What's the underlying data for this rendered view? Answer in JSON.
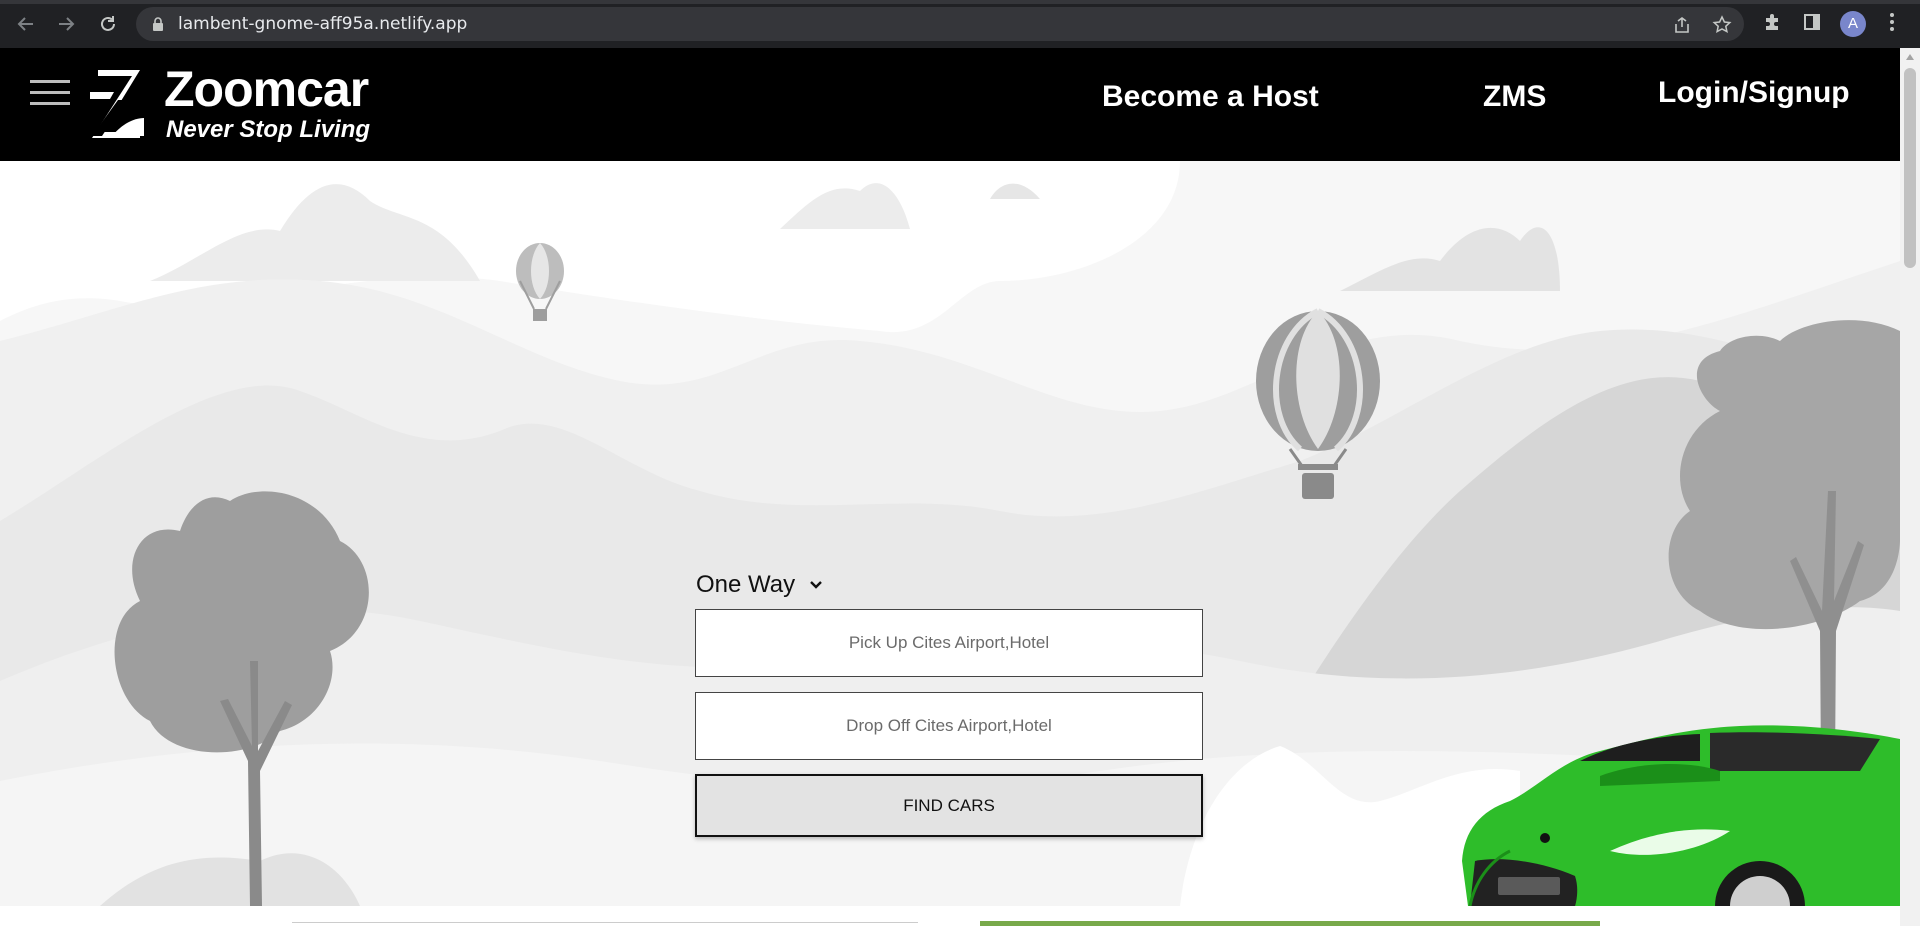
{
  "browser": {
    "url": "lambent-gnome-aff95a.netlify.app",
    "profile_initial": "A"
  },
  "header": {
    "brand": "Zoomcar",
    "tagline": "Never Stop Living",
    "nav": {
      "become_host": "Become a Host",
      "zms": "ZMS",
      "login": "Login/Signup"
    }
  },
  "search": {
    "trip_type": "One Way",
    "pickup_placeholder": "Pick Up Cites Airport,Hotel",
    "dropoff_placeholder": "Drop Off Cites Airport,Hotel",
    "find_button": "FIND CARS"
  },
  "colors": {
    "header_bg": "#000000",
    "car_green": "#2ebd2a",
    "button_bg": "#e3e3e3"
  }
}
